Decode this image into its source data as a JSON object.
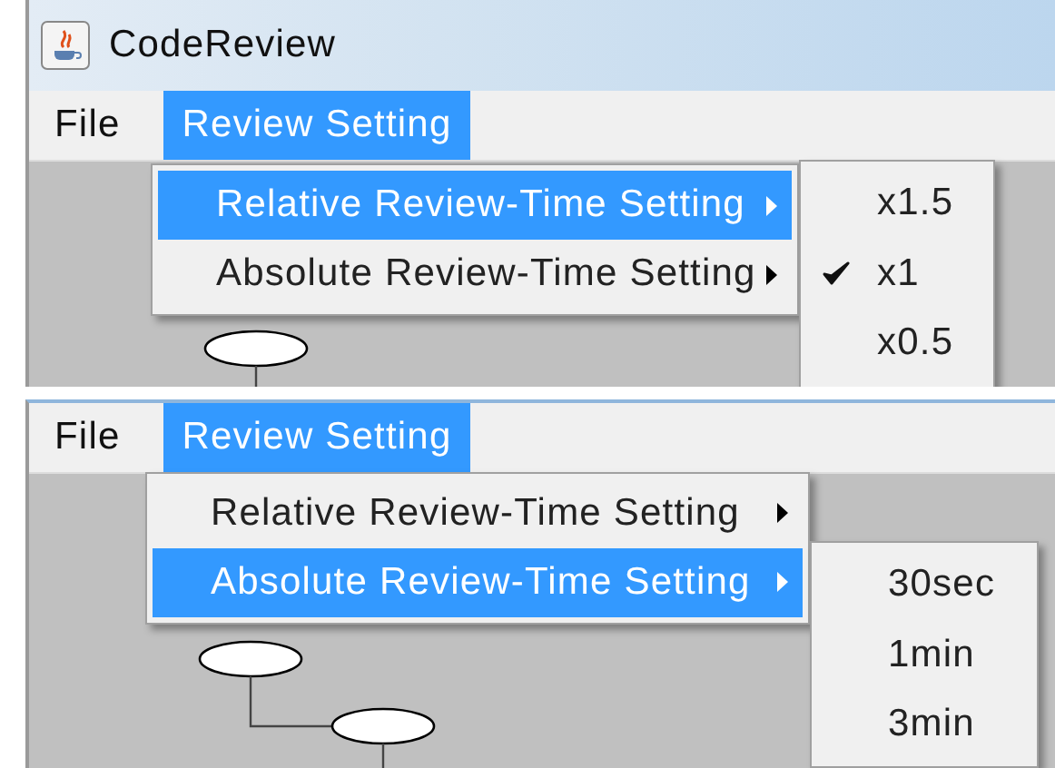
{
  "screens": [
    {
      "window": {
        "title": "CodeReview"
      },
      "menu_bar": [
        {
          "label": "File",
          "selected": false
        },
        {
          "label": "Review Setting",
          "selected": true
        }
      ],
      "menu": [
        {
          "label": "Relative Review-Time Setting",
          "selected": true
        },
        {
          "label": "Absolute Review-Time Setting",
          "selected": false
        }
      ],
      "submenu": [
        {
          "label": "x1.5",
          "checked": false
        },
        {
          "label": "x1",
          "checked": true
        },
        {
          "label": "x0.5",
          "checked": false
        }
      ]
    },
    {
      "menu_bar": [
        {
          "label": "File",
          "selected": false
        },
        {
          "label": "Review Setting",
          "selected": true
        }
      ],
      "menu": [
        {
          "label": "Relative Review-Time Setting",
          "selected": false
        },
        {
          "label": "Absolute Review-Time Setting",
          "selected": true
        }
      ],
      "submenu": [
        {
          "label": "30sec"
        },
        {
          "label": "1min"
        },
        {
          "label": "3min"
        }
      ]
    }
  ]
}
